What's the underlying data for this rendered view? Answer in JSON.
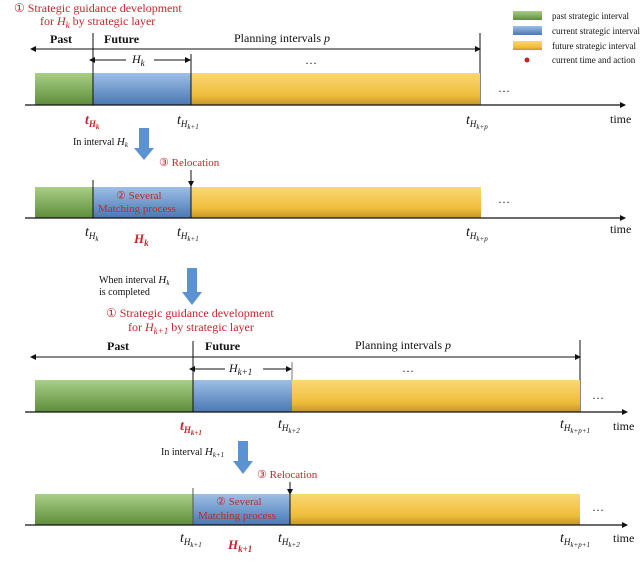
{
  "colors": {
    "past": "#7aab4a",
    "current": "#5b8fcc",
    "future": "#f2c23a",
    "annotation_red": "#c0272d",
    "flow_arrow": "#5b92d1"
  },
  "legend": {
    "items": [
      {
        "label": "past strategic interval",
        "kind": "past"
      },
      {
        "label": "current strategic interval",
        "kind": "current"
      },
      {
        "label": "future strategic interval",
        "kind": "future"
      },
      {
        "label": "current time and action",
        "kind": "dot"
      }
    ]
  },
  "section1": {
    "step1_line1": "① Strategic guidance development",
    "step1_line2_pre": "for ",
    "step1_H": "H",
    "step1_H_sub": "k",
    "step1_line2_post": " by strategic layer",
    "past": "Past",
    "future": "Future",
    "planning": "Planning intervals ",
    "planning_var": "p",
    "interval_H": "H",
    "interval_sub": "k",
    "dots": "…",
    "ticks": [
      {
        "t": "t",
        "H": "H",
        "sub": "k",
        "red": true
      },
      {
        "t": "t",
        "H": "H",
        "sub": "k+1",
        "red": false
      },
      {
        "t": "t",
        "H": "H",
        "sub": "k+p",
        "red": false
      }
    ],
    "time": "time"
  },
  "flow1": {
    "label_pre": "In interval ",
    "label_H": "H",
    "label_sub": "k"
  },
  "section2": {
    "relocation": "③ Relocation",
    "matching_line1": "② Several",
    "matching_line2": "Matching process",
    "current_H": "H",
    "current_sub": "k",
    "dots": "…",
    "ticks": [
      {
        "t": "t",
        "H": "H",
        "sub": "k"
      },
      {
        "t": "t",
        "H": "H",
        "sub": "k+1"
      },
      {
        "t": "t",
        "H": "H",
        "sub": "k+p"
      }
    ],
    "time": "time"
  },
  "flow2": {
    "label_line1_pre": "When interval ",
    "label_H": "H",
    "label_sub": "k",
    "label_line2": "is completed"
  },
  "section3": {
    "step1_line1": "① Strategic guidance development",
    "step1_line2_pre": "for ",
    "step1_H": "H",
    "step1_H_sub": "k+1",
    "step1_line2_post": " by strategic layer",
    "past": "Past",
    "future": "Future",
    "planning": "Planning intervals ",
    "planning_var": "p",
    "interval_H": "H",
    "interval_sub": "k+1",
    "dots": "…",
    "ticks": [
      {
        "t": "t",
        "H": "H",
        "sub": "k+1",
        "red": true
      },
      {
        "t": "t",
        "H": "H",
        "sub": "k+2",
        "red": false
      },
      {
        "t": "t",
        "H": "H",
        "sub": "k+p+1",
        "red": false
      }
    ],
    "time": "time"
  },
  "flow3": {
    "label_pre": "In interval ",
    "label_H": "H",
    "label_sub": "k+1"
  },
  "section4": {
    "relocation": "③ Relocation",
    "matching_line1": "② Several",
    "matching_line2": "Matching process",
    "current_H": "H",
    "current_sub": "k+1",
    "dots": "…",
    "ticks": [
      {
        "t": "t",
        "H": "H",
        "sub": "k+1"
      },
      {
        "t": "t",
        "H": "H",
        "sub": "k+2"
      },
      {
        "t": "t",
        "H": "H",
        "sub": "k+p+1"
      }
    ],
    "time": "time"
  }
}
